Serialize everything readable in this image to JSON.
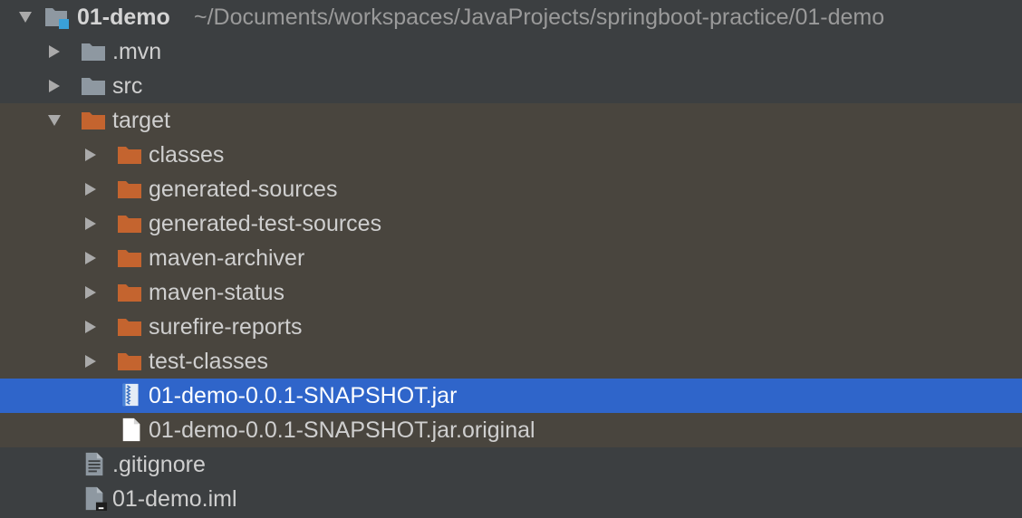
{
  "project": {
    "name": "01-demo",
    "path": "~/Documents/workspaces/JavaProjects/springboot-practice/01-demo"
  },
  "items": [
    {
      "label": ".mvn",
      "icon": "folder-icon",
      "expanded": false
    },
    {
      "label": "src",
      "icon": "folder-icon",
      "expanded": false
    },
    {
      "label": "target",
      "icon": "excluded-folder-icon",
      "expanded": true
    },
    {
      "label": "classes",
      "icon": "excluded-folder-icon",
      "expanded": false
    },
    {
      "label": "generated-sources",
      "icon": "excluded-folder-icon",
      "expanded": false
    },
    {
      "label": "generated-test-sources",
      "icon": "excluded-folder-icon",
      "expanded": false
    },
    {
      "label": "maven-archiver",
      "icon": "excluded-folder-icon",
      "expanded": false
    },
    {
      "label": "maven-status",
      "icon": "excluded-folder-icon",
      "expanded": false
    },
    {
      "label": "surefire-reports",
      "icon": "excluded-folder-icon",
      "expanded": false
    },
    {
      "label": "test-classes",
      "icon": "excluded-folder-icon",
      "expanded": false
    },
    {
      "label": "01-demo-0.0.1-SNAPSHOT.jar",
      "icon": "jar-archive-icon",
      "selected": true
    },
    {
      "label": "01-demo-0.0.1-SNAPSHOT.jar.original",
      "icon": "file-icon"
    },
    {
      "label": ".gitignore",
      "icon": "text-file-icon"
    },
    {
      "label": "01-demo.iml",
      "icon": "iml-file-icon"
    }
  ],
  "colors": {
    "background": "#3c3f41",
    "excluded_row": "#49453e",
    "selection": "#2f65ca",
    "folder": "#8e98a1",
    "excluded_folder": "#c4642f"
  }
}
